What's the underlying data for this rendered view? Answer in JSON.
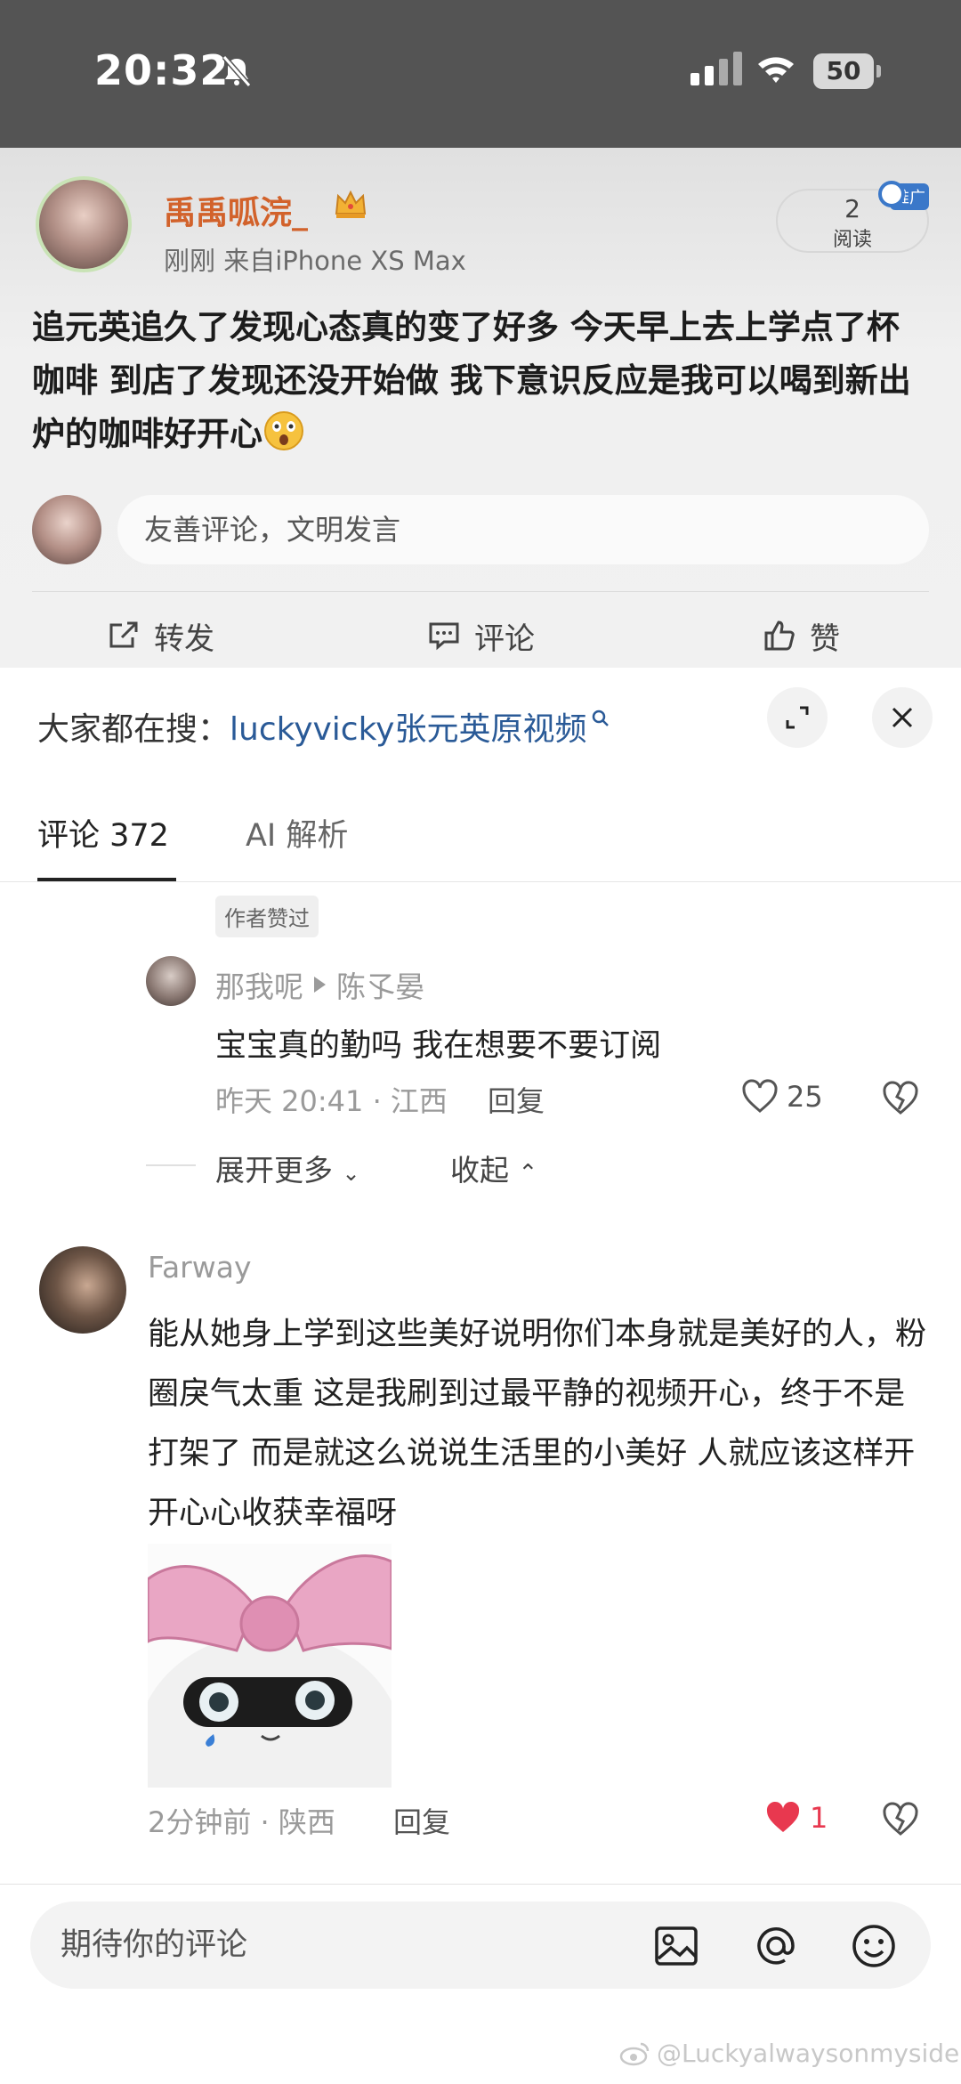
{
  "status_bar": {
    "time": "20:32",
    "battery": "50"
  },
  "post": {
    "username": "禹禹呱浣_",
    "meta": "刚刚  来自iPhone XS Max",
    "read_count": "2",
    "read_label": "阅读",
    "promo_badge": "推广",
    "text": "追元英追久了发现心态真的变了好多 今天早上去上学点了杯咖啡 到店了发现还没开始做 我下意识反应是我可以喝到新出炉的咖啡好开心",
    "comment_placeholder": "友善评论，文明发言",
    "actions": {
      "repost": "转发",
      "comment": "评论",
      "like": "赞"
    }
  },
  "sheet": {
    "search_prefix": "大家都在搜：",
    "search_keyword": "luckyvicky张元英原视频",
    "tabs": [
      {
        "label": "评论 372"
      },
      {
        "label": "AI 解析"
      }
    ],
    "author_liked": "作者赞过",
    "reply": {
      "from": "那我呢",
      "to": "陈孓晏",
      "text": "宝宝真的勤吗 我在想要不要订阅",
      "meta": "昨天 20:41 · 江西",
      "reply_label": "回复",
      "likes": "25"
    },
    "expand_more": "展开更多",
    "collapse": "收起",
    "comment2": {
      "name": "Farway",
      "text": "能从她身上学到这些美好说明你们本身就是美好的人，粉圈戾气太重 这是我刷到过最平静的视频开心，终于不是打架了 而是就这么说说生活里的小美好 人就应该这样开开心心收获幸福呀",
      "meta": "2分钟前 · 陕西",
      "reply_label": "回复",
      "likes": "1"
    },
    "input_placeholder": "期待你的评论"
  },
  "watermark": "@Luckyalwaysonmyside",
  "colors": {
    "username": "#d2622b",
    "search_keyword": "#2a5a97",
    "liked_heart": "#e8384f"
  }
}
